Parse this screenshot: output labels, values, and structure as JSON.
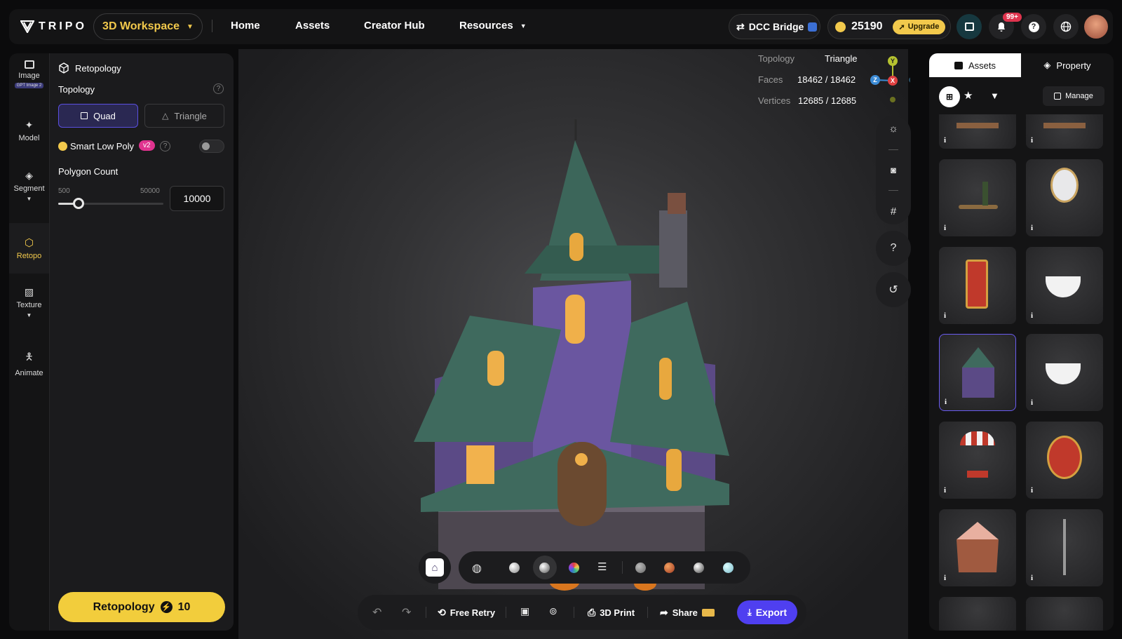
{
  "app": {
    "logo_text": "TRIPO"
  },
  "nav": {
    "workspace_label": "3D Workspace",
    "links": [
      "Home",
      "Assets",
      "Creator Hub",
      "Resources"
    ],
    "dcc_bridge": "DCC Bridge",
    "credits": "25190",
    "upgrade": "Upgrade",
    "notif_badge": "99+"
  },
  "rail": {
    "items": [
      {
        "label": "Image",
        "sub": "GPT Image 2"
      },
      {
        "label": "Model"
      },
      {
        "label": "Segment"
      },
      {
        "label": "Retopo"
      },
      {
        "label": "Texture"
      },
      {
        "label": "Animate"
      }
    ]
  },
  "panel": {
    "title": "Retopology",
    "topology_label": "Topology",
    "quad": "Quad",
    "triangle": "Triangle",
    "smart_low_poly": "Smart Low Poly",
    "version_badge": "v2",
    "polygon_count_label": "Polygon Count",
    "min": "500",
    "max": "50000",
    "value": "10000",
    "slider_fraction": 0.192,
    "cta_label": "Retopology",
    "cta_cost": "10"
  },
  "stats": {
    "topology_k": "Topology",
    "topology_v": "Triangle",
    "faces_k": "Faces",
    "faces_v": "18462 / 18462",
    "vertices_k": "Vertices",
    "vertices_v": "12685 / 12685"
  },
  "axes": {
    "y": "Y",
    "z": "Z",
    "x": "X"
  },
  "viewport_tools": {
    "help": "?"
  },
  "actions": {
    "free_retry": "Free Retry",
    "print": "3D Print",
    "share": "Share",
    "export": "Export"
  },
  "assets_panel": {
    "tab_assets": "Assets",
    "tab_property": "Property",
    "manage": "Manage",
    "info_glyph": "i"
  },
  "colors": {
    "accent": "#f2cd3c",
    "primary": "#4f3ff0",
    "badge": "#e0338f"
  }
}
